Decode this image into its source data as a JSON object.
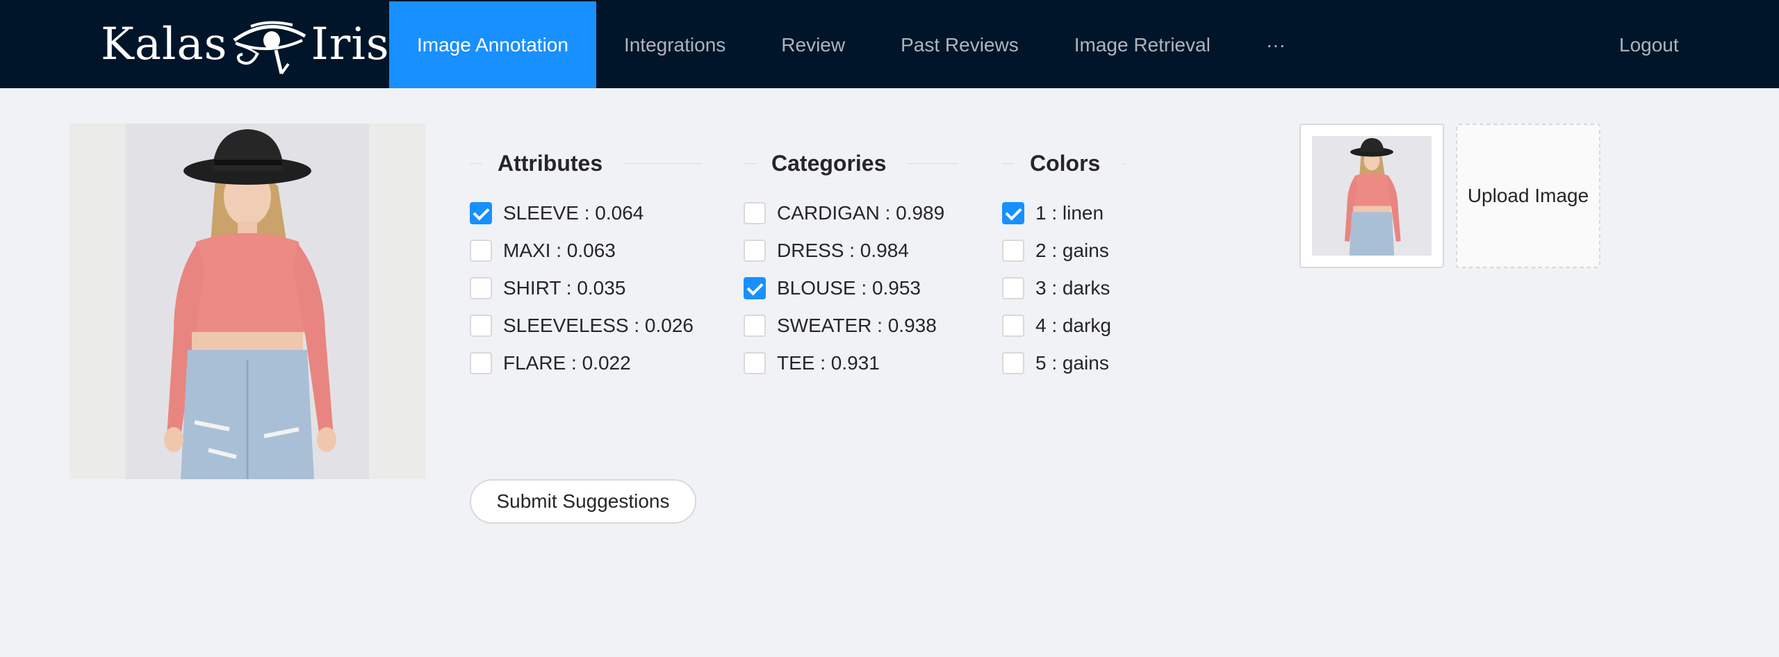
{
  "header": {
    "logo_left": "Kalas",
    "logo_right": "Iris",
    "nav": [
      {
        "label": "Image Annotation",
        "active": true
      },
      {
        "label": "Integrations",
        "active": false
      },
      {
        "label": "Review",
        "active": false
      },
      {
        "label": "Past Reviews",
        "active": false
      },
      {
        "label": "Image Retrieval",
        "active": false
      },
      {
        "label": "···",
        "active": false
      }
    ],
    "logout": "Logout"
  },
  "attributes": {
    "title": "Attributes",
    "options": [
      {
        "label": "SLEEVE : 0.064",
        "checked": true
      },
      {
        "label": "MAXI : 0.063",
        "checked": false
      },
      {
        "label": "SHIRT : 0.035",
        "checked": false
      },
      {
        "label": "SLEEVELESS : 0.026",
        "checked": false
      },
      {
        "label": "FLARE : 0.022",
        "checked": false
      }
    ]
  },
  "categories": {
    "title": "Categories",
    "options": [
      {
        "label": "CARDIGAN : 0.989",
        "checked": false
      },
      {
        "label": "DRESS : 0.984",
        "checked": false
      },
      {
        "label": "BLOUSE : 0.953",
        "checked": true
      },
      {
        "label": "SWEATER : 0.938",
        "checked": false
      },
      {
        "label": "TEE : 0.931",
        "checked": false
      }
    ]
  },
  "colors": {
    "title": "Colors",
    "options": [
      {
        "label": "1 : linen",
        "checked": true
      },
      {
        "label": "2 : gains",
        "checked": false
      },
      {
        "label": "3 : darks",
        "checked": false
      },
      {
        "label": "4 : darkg",
        "checked": false
      },
      {
        "label": "5 : gains",
        "checked": false
      }
    ]
  },
  "submit_label": "Submit Suggestions",
  "upload_label": "Upload Image",
  "palette": {
    "header_bg": "#001529",
    "active_nav": "#1890ff",
    "page_bg": "#f0f2f5",
    "top_color": "#ec8a84",
    "jeans_color": "#a9bfd6",
    "hat_color": "#222222"
  }
}
